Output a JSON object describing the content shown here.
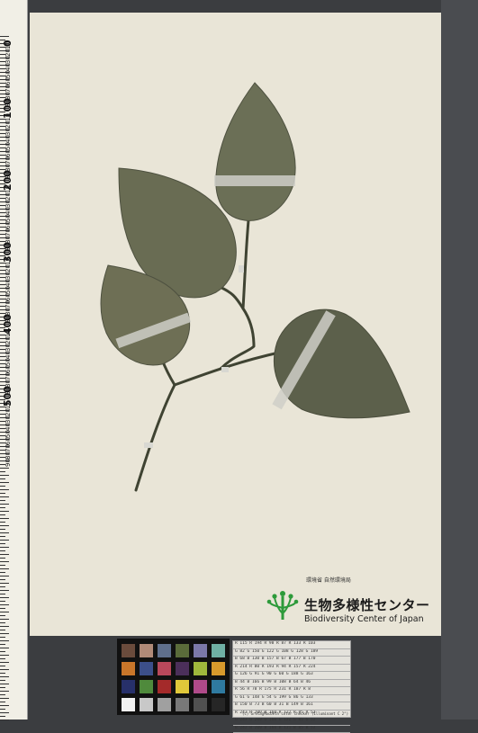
{
  "ruler": {
    "major_labels": [
      "0",
      "100",
      "200",
      "300",
      "400",
      "500"
    ],
    "minor_labels": [
      "10",
      "20",
      "30",
      "40",
      "50",
      "60",
      "70",
      "80",
      "90"
    ]
  },
  "institution": {
    "ministry": "環境省 自然環境局",
    "name_jp": "生物多様性センター",
    "name_en": "Biodiversity Center of Japan"
  },
  "color_chart": {
    "rows": [
      [
        "#6a4b3c",
        "#b08a78",
        "#5f6f8c",
        "#5a6b3a",
        "#7b78a8",
        "#6fb0a4"
      ],
      [
        "#c9762a",
        "#3c4f8a",
        "#b8485b",
        "#4b2f5a",
        "#9fb83c",
        "#d89a2c"
      ],
      [
        "#27306a",
        "#4f8a3c",
        "#a42a2a",
        "#e0c83a",
        "#b04a8a",
        "#2f7aa0"
      ],
      [
        "#f2f2f2",
        "#c8c8c8",
        "#a0a0a0",
        "#787878",
        "#505050",
        "#262626"
      ]
    ]
  },
  "reference_table": {
    "rows": [
      "R 115  R 194  R 98   R 87   R 133  R 103",
      "G 82   G 150  G 122  G 108  G 128  G 189",
      "B 68   B 130  B 157  B 67   B 177  B 170",
      "R 214  R 80   R 193  R 94   R 157  R 224",
      "G 126  G 91   G 90   G 60   G 188  G 163",
      "B 44   B 166  B 99   B 108  B 64   B 46",
      "R 56   R 70   R 175  R 231  R 187  R 8",
      "G 61   G 148  G 54   G 199  G 86   G 133",
      "B 150  B 73   B 60   B 31   B 149  B 161",
      "R 243  R 200  R 160  R 122  R 85   R 52",
      "G 243  G 200  G 160  G 122  G 85   G 52",
      "B 242  B 200  B 160  B 121  B 85   B 52"
    ],
    "footer": "(c) GretagMacbeth color checker  (Illuminant C 2°)"
  }
}
